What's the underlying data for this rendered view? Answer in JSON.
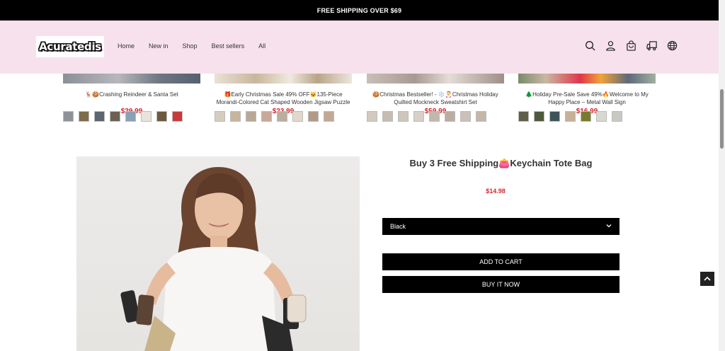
{
  "announcement": "FREE SHIPPING OVER $69",
  "header": {
    "logo_text": "Acuratedis",
    "nav": [
      "Home",
      "New in",
      "Shop",
      "Best sellers",
      "All"
    ],
    "icons": [
      "search-icon",
      "account-icon",
      "cart-icon",
      "shipping-icon",
      "globe-icon"
    ]
  },
  "products": [
    {
      "title": "🦌🍪Crashing Reindeer & Santa Set",
      "price": "$29.99",
      "swatch_count": 8
    },
    {
      "title": "🎁Early Christmas Sale 49% OFF🐱135-Piece Morandi-Colored Cat Shaped Wooden Jigsaw Puzzle",
      "price": "$23.99",
      "swatch_count": 8
    },
    {
      "title": "🍪Christmas Bestseller! - ❄️🎅Christmas Holiday Quilted Mockneck Sweatshirt Set",
      "price": "$59.99",
      "swatch_count": 8
    },
    {
      "title": "🌲Holiday Pre-Sale Save 49%🔥Welcome to My Happy Place – Metal Wall Sign",
      "price": "$16.99",
      "swatch_count": 7
    }
  ],
  "product_detail": {
    "title": "Buy 3 Free Shipping👛Keychain Tote Bag",
    "price": "$14.98",
    "color_select": "Black",
    "add_to_cart": "ADD TO CART",
    "buy_now": "BUY IT NOW"
  },
  "colors": {
    "header_bg": "#f6e1ec",
    "price_red": "#d3272f",
    "button_bg": "#000000"
  }
}
